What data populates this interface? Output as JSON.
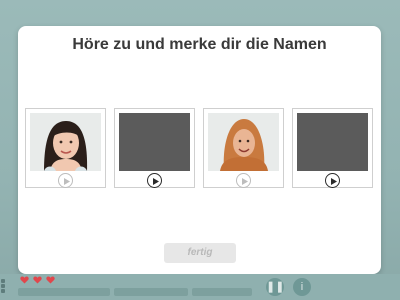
{
  "dialog": {
    "title": "Höre zu und merke dir die Namen",
    "done_label": "fertig"
  },
  "cards": [
    {
      "photo": "girl-portrait",
      "play_state": "inactive",
      "play_icon": "play-icon"
    },
    {
      "photo": "placeholder-dark",
      "play_state": "active",
      "play_icon": "play-icon"
    },
    {
      "photo": "girl-hijab-portrait",
      "play_state": "inactive",
      "play_icon": "play-icon"
    },
    {
      "photo": "placeholder-dark",
      "play_state": "active",
      "play_icon": "play-icon"
    }
  ],
  "status_bar": {
    "hearts": 3,
    "heart_color": "#e0474c",
    "controls": [
      {
        "icon": "pause-icon",
        "glyph": "❚❚"
      },
      {
        "icon": "info-icon",
        "glyph": "i"
      }
    ]
  }
}
